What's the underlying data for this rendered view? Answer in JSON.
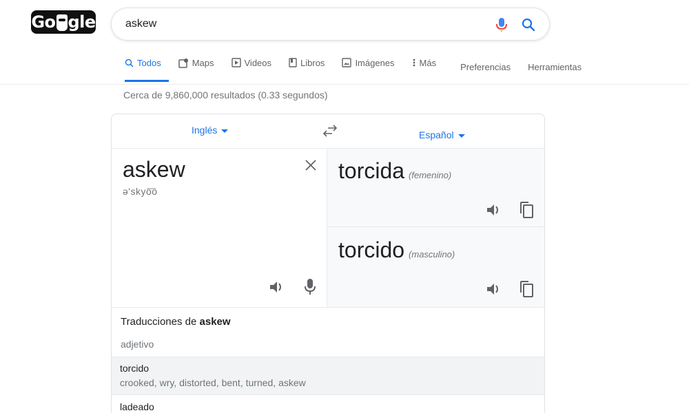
{
  "logo": {
    "text_left": "Go",
    "text_right": "gle"
  },
  "search": {
    "query": "askew"
  },
  "tabs": [
    {
      "label": "Todos",
      "icon": "search-icon",
      "active": true
    },
    {
      "label": "Maps",
      "icon": "map-pin-icon"
    },
    {
      "label": "Videos",
      "icon": "video-icon"
    },
    {
      "label": "Libros",
      "icon": "book-icon"
    },
    {
      "label": "Imágenes",
      "icon": "image-icon"
    },
    {
      "label": "Más",
      "icon": "more-vert-icon"
    },
    {
      "label": "Preferencias"
    },
    {
      "label": "Herramientas"
    }
  ],
  "result_stats": "Cerca de 9,860,000 resultados (0.33 segundos)",
  "translator": {
    "source_lang": "Inglés",
    "target_lang": "Español",
    "source_word": "askew",
    "phonetic": "ə'skyo͞o",
    "translations": [
      {
        "word": "torcida",
        "gender": "(femenino)"
      },
      {
        "word": "torcido",
        "gender": "(masculino)"
      }
    ]
  },
  "dictionary": {
    "title_prefix": "Traducciones de",
    "title_word": "askew",
    "part_of_speech": "adjetivo",
    "entries": [
      {
        "word": "torcido",
        "synonyms": "crooked, wry, distorted, bent, turned, askew"
      },
      {
        "word": "ladeado"
      }
    ]
  },
  "colors": {
    "accent": "#1a73e8",
    "muted": "#70757a",
    "text": "#202124"
  }
}
